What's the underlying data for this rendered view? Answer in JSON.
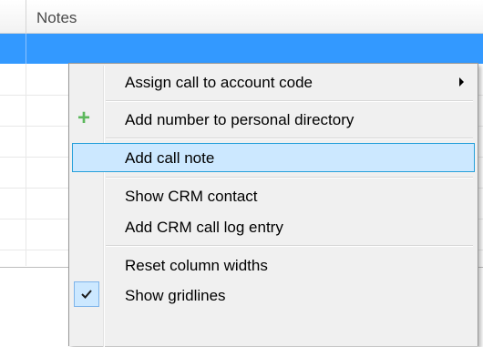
{
  "grid": {
    "column_header": "Notes"
  },
  "menu": {
    "items": [
      {
        "label": "Assign call to account code",
        "submenu": true,
        "icon": "submenu-arrow-icon"
      },
      {
        "label": "Add number to personal directory",
        "icon": "plus-icon",
        "icon_color": "#5cb85c"
      },
      {
        "label": "Add call note",
        "highlighted": true
      },
      {
        "label": "Show CRM contact"
      },
      {
        "label": "Add CRM call log entry"
      },
      {
        "label": "Reset column widths"
      },
      {
        "label": "Show gridlines",
        "checked": true,
        "icon": "check-icon"
      }
    ]
  },
  "colors": {
    "selection_row": "#3399ff",
    "menu_background": "#f0f0f0",
    "highlight_background": "#cce8ff",
    "highlight_border": "#26a0da"
  }
}
